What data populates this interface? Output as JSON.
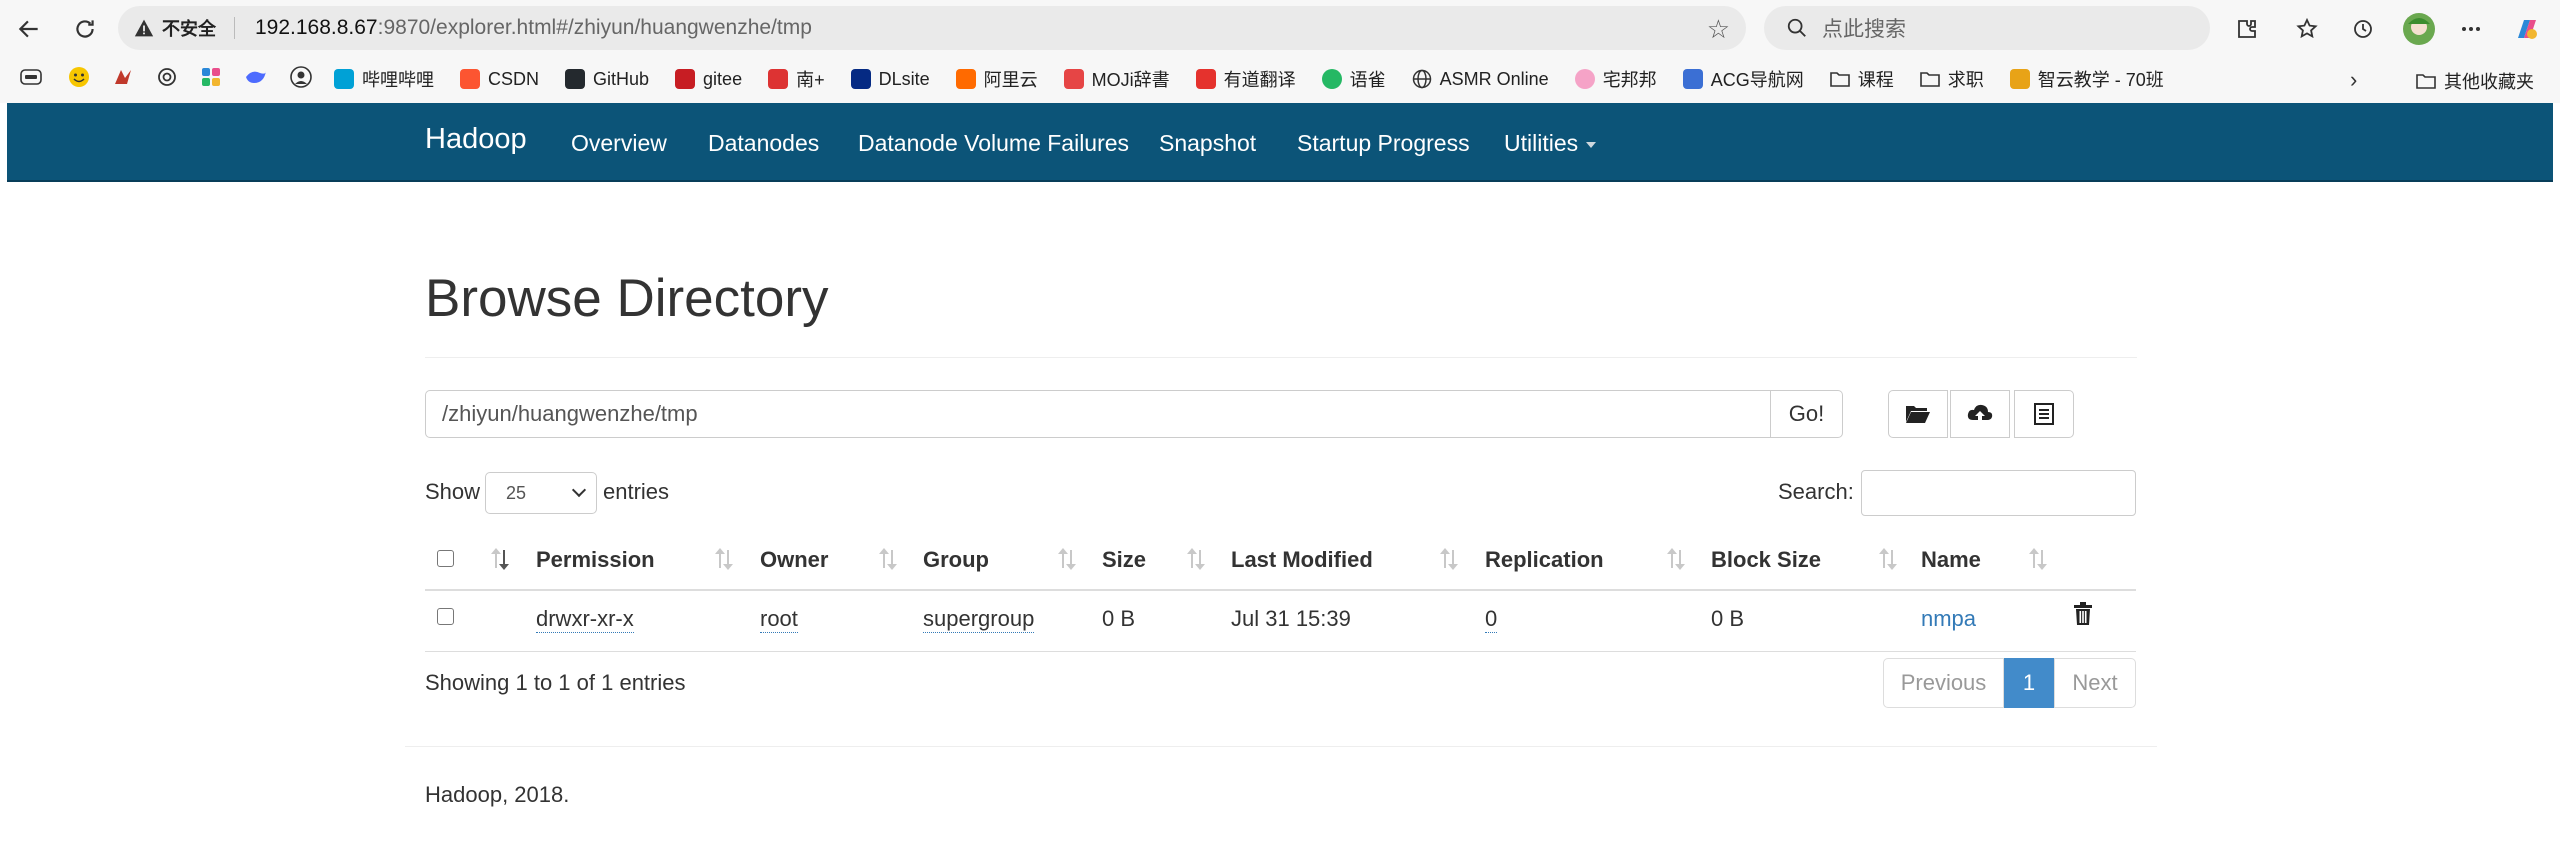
{
  "browser": {
    "security_label": "不安全",
    "url_host": "192.168.8.67",
    "url_rest": ":9870/explorer.html#/zhiyun/huangwenzhe/tmp",
    "search_placeholder": "点此搜索",
    "bookmarks": [
      {
        "label": "哔哩哔哩",
        "icon": "bilibili-icon",
        "color": "#00a1d6"
      },
      {
        "label": "CSDN",
        "icon": "csdn-icon",
        "color": "#fc5531"
      },
      {
        "label": "GitHub",
        "icon": "github-icon",
        "color": "#24292e"
      },
      {
        "label": "gitee",
        "icon": "gitee-icon",
        "color": "#c71d23"
      },
      {
        "label": "南+",
        "icon": "south-plus-icon",
        "color": "#d33"
      },
      {
        "label": "DLsite",
        "icon": "dlsite-icon",
        "color": "#052a83"
      },
      {
        "label": "阿里云",
        "icon": "aliyun-icon",
        "color": "#ff6a00"
      },
      {
        "label": "MOJi辞書",
        "icon": "moji-icon",
        "color": "#e64545"
      },
      {
        "label": "有道翻译",
        "icon": "youdao-icon",
        "color": "#e5322d"
      },
      {
        "label": "语雀",
        "icon": "yuque-icon",
        "color": "#25b864"
      },
      {
        "label": "ASMR Online",
        "icon": "globe-icon",
        "color": "#555555"
      },
      {
        "label": "宅邦邦",
        "icon": "zhaibangbang-icon",
        "color": "#f5a3c7"
      },
      {
        "label": "ACG导航网",
        "icon": "acg-icon",
        "color": "#3b6fd4"
      },
      {
        "label": "课程",
        "icon": "folder-icon",
        "color": "#555555"
      },
      {
        "label": "求职",
        "icon": "folder-icon",
        "color": "#555555"
      },
      {
        "label": "智云教学 - 70班",
        "icon": "zhiyun-icon",
        "color": "#e8a317"
      }
    ],
    "other_bookmarks": "其他收藏夹"
  },
  "navbar": {
    "brand": "Hadoop",
    "items": [
      "Overview",
      "Datanodes",
      "Datanode Volume Failures",
      "Snapshot",
      "Startup Progress",
      "Utilities"
    ]
  },
  "page": {
    "title": "Browse Directory",
    "path": "/zhiyun/huangwenzhe/tmp",
    "go_label": "Go!",
    "show_label": "Show",
    "entries_value": "25",
    "entries_label": "entries",
    "search_label": "Search:",
    "columns": [
      "Permission",
      "Owner",
      "Group",
      "Size",
      "Last Modified",
      "Replication",
      "Block Size",
      "Name"
    ],
    "rows": [
      {
        "permission": "drwxr-xr-x",
        "owner": "root",
        "group": "supergroup",
        "size": "0 B",
        "last_modified": "Jul 31 15:39",
        "replication": "0",
        "block_size": "0 B",
        "name": "nmpa"
      }
    ],
    "info": "Showing 1 to 1 of 1 entries",
    "pagination": {
      "previous": "Previous",
      "current": "1",
      "next": "Next"
    },
    "footer": "Hadoop, 2018."
  },
  "colors": {
    "navbar": "#0c5478",
    "link": "#337ab7",
    "active_page": "#428bca"
  }
}
